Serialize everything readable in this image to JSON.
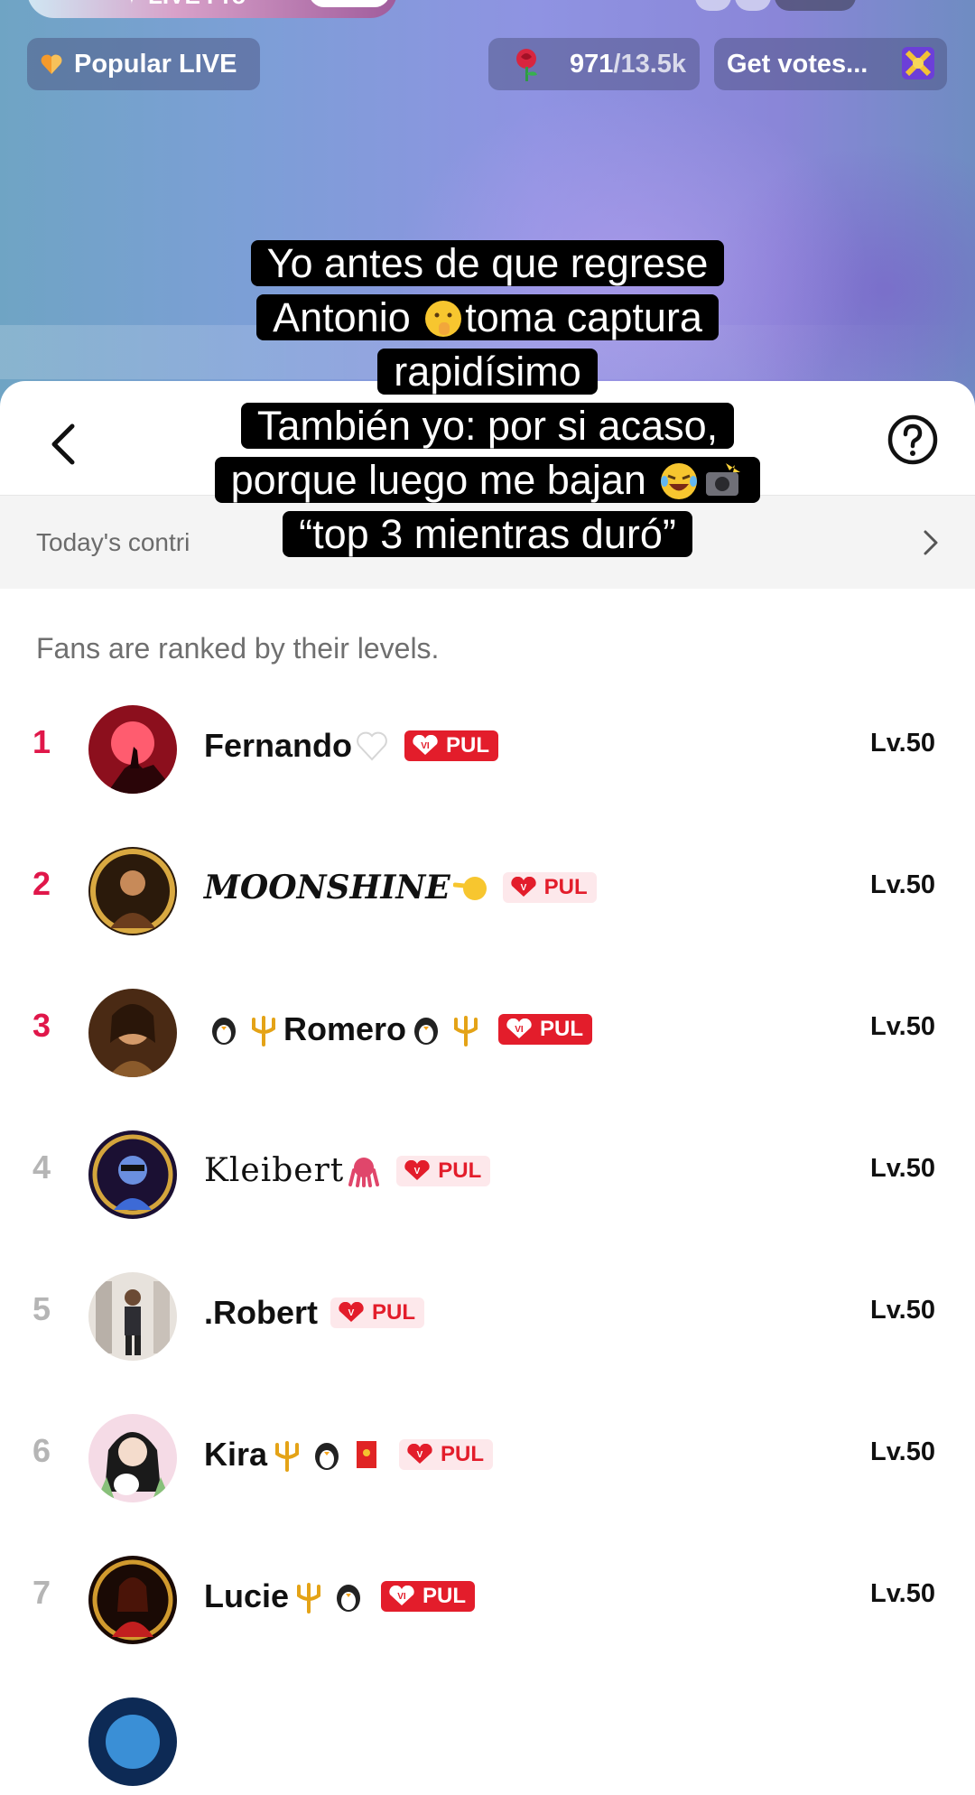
{
  "live_header": {
    "live_badge": "✦ LIVE Pro",
    "popular_live": "Popular LIVE",
    "votes_current": "971",
    "votes_total": "/13.5k",
    "get_votes": "Get votes..."
  },
  "caption": {
    "lines": [
      "Yo antes de que regrese",
      "Antonio",
      "toma captura",
      "rapidísimo",
      "También yo: por si acaso,",
      "porque luego me bajan",
      "“top 3 mientras duró”"
    ]
  },
  "sheet": {
    "contribution_label": "Today's contri",
    "ranking_note": "Fans are ranked by their levels."
  },
  "fans": [
    {
      "rank": "1",
      "name": "Fernando",
      "badge": "PUL",
      "level": "Lv.50"
    },
    {
      "rank": "2",
      "name": "MOONSHINE",
      "badge": "PUL",
      "level": "Lv.50"
    },
    {
      "rank": "3",
      "name": "Romero",
      "badge": "PUL",
      "level": "Lv.50"
    },
    {
      "rank": "4",
      "name": "Kleibert",
      "badge": "PUL",
      "level": "Lv.50"
    },
    {
      "rank": "5",
      "name": ".Robert",
      "badge": "PUL",
      "level": "Lv.50"
    },
    {
      "rank": "6",
      "name": "Kira",
      "badge": "PUL",
      "level": "Lv.50"
    },
    {
      "rank": "7",
      "name": "Lucie",
      "badge": "PUL",
      "level": "Lv.50"
    }
  ],
  "colors": {
    "top_rank": "#e0174a",
    "rank_other": "#b5b5b5",
    "pul_red": "#e31d2b"
  },
  "icons": {
    "popular": "heart-icon",
    "votes": "rose-icon",
    "get_votes": "gift-icon",
    "back": "chevron-left-icon",
    "help": "question-circle-icon",
    "contribution": "chevron-right-icon"
  }
}
